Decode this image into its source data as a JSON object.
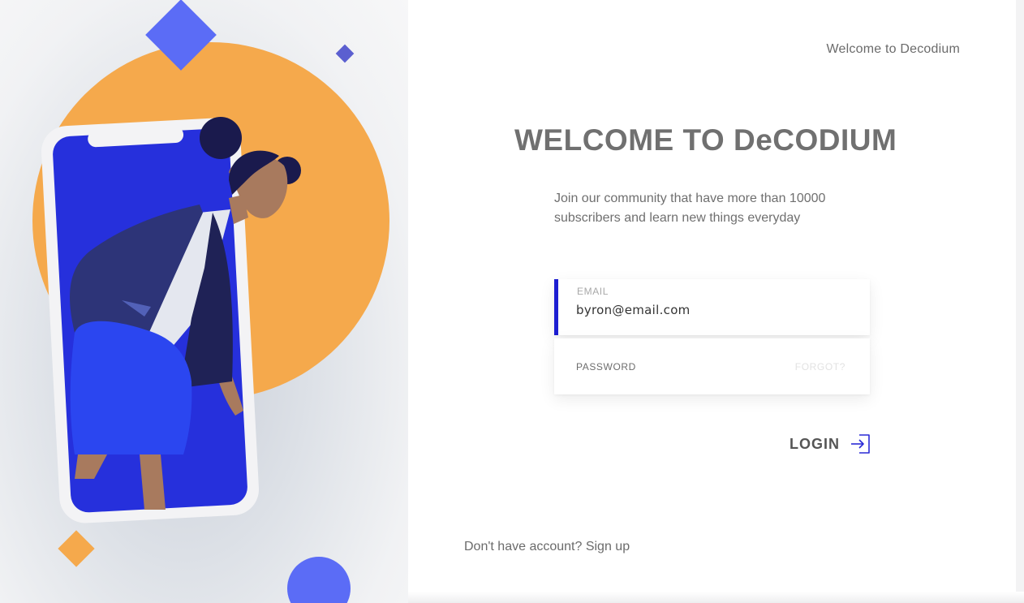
{
  "header": {
    "top_link": "Welcome to Decodium"
  },
  "main": {
    "title": "WELCOME TO DeCODIUM",
    "intro_line_1": "Join our community that have more than 10000",
    "intro_line_2": "subscribers and learn new things everyday"
  },
  "form": {
    "email": {
      "label": "EMAIL",
      "value": "byron@email.com"
    },
    "password": {
      "label": "PASSWORD",
      "value": "",
      "forgot_label": "FORGOT?"
    },
    "login_label": "LOGIN",
    "login_icon": "login-arrow-icon"
  },
  "footer": {
    "signup_prompt": "Don't have account?",
    "signup_link": "Sign up"
  },
  "illustration": {
    "name": "woman-stepping-out-of-phone",
    "colors": {
      "accent_blue": "#1c1dd1",
      "phone_screen": "#2630dc",
      "orange_circle": "#f5a94c",
      "diamond_blue": "#5b6cf6",
      "diamond_orange": "#f5a94c",
      "jacket": "#2d3478",
      "skirt": "#2b46f0",
      "skin": "#a87a5e",
      "hair": "#1a1a4d"
    }
  }
}
